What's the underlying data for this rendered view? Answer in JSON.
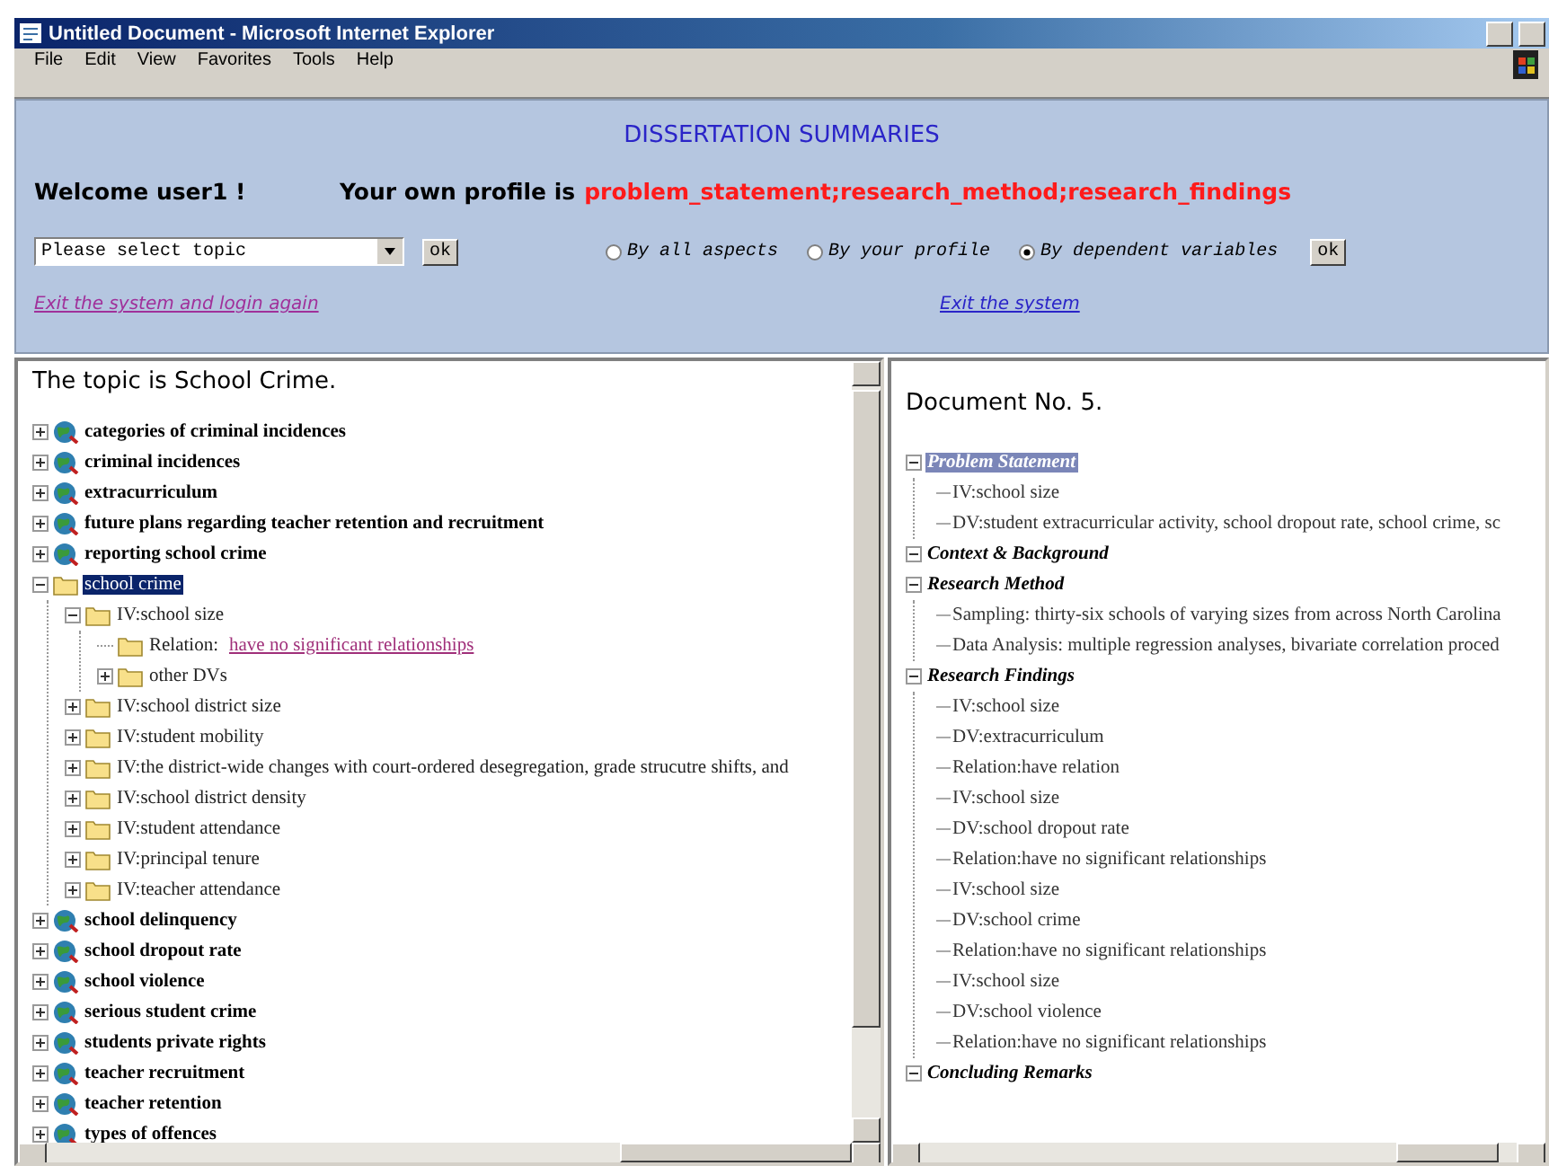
{
  "window": {
    "title": "Untitled Document - Microsoft Internet Explorer"
  },
  "menu": [
    "File",
    "Edit",
    "View",
    "Favorites",
    "Tools",
    "Help"
  ],
  "header": {
    "title": "DISSERTATION SUMMARIES",
    "welcome": "Welcome user1 !",
    "profile_label": "Your own profile is",
    "profile_value": "problem_statement;research_method;research_findings",
    "topic_select": {
      "value": "Please select topic"
    },
    "topic_ok": "ok",
    "view_options": [
      {
        "label": "By all aspects",
        "selected": false
      },
      {
        "label": "By your profile",
        "selected": false
      },
      {
        "label": "By dependent variables",
        "selected": true
      }
    ],
    "view_ok": "ok",
    "links": [
      {
        "label": "Exit the system and login again",
        "visited": true
      },
      {
        "label": "Exit the system",
        "visited": false
      }
    ]
  },
  "topic_tree": {
    "heading": "The topic is School Crime.",
    "items": [
      {
        "kind": "topic",
        "label": "categories of criminal incidences",
        "expanded": false,
        "selected": false
      },
      {
        "kind": "topic",
        "label": "criminal incidences",
        "expanded": false,
        "selected": false
      },
      {
        "kind": "topic",
        "label": "extracurriculum",
        "expanded": false,
        "selected": false
      },
      {
        "kind": "topic",
        "label": "future plans regarding teacher retention and recruitment",
        "expanded": false,
        "selected": false
      },
      {
        "kind": "topic",
        "label": "reporting school crime",
        "expanded": false,
        "selected": false
      },
      {
        "kind": "folder",
        "label": "school crime",
        "expanded": true,
        "selected": true,
        "children": [
          {
            "kind": "folder",
            "label": "IV:school size",
            "expanded": true,
            "selected": false,
            "children": [
              {
                "kind": "folder",
                "label": "Relation:",
                "link": "have no significant relationships",
                "selected": false
              },
              {
                "kind": "folder",
                "label": "other DVs",
                "expanded": false,
                "selected": false
              }
            ]
          },
          {
            "kind": "folder",
            "label": "IV:school district size",
            "expanded": false,
            "selected": false
          },
          {
            "kind": "folder",
            "label": "IV:student mobility",
            "expanded": false,
            "selected": false
          },
          {
            "kind": "folder",
            "label": "IV:the district-wide changes with court-ordered desegregation, grade strucutre shifts, and",
            "expanded": false,
            "selected": false
          },
          {
            "kind": "folder",
            "label": "IV:school district density",
            "expanded": false,
            "selected": false
          },
          {
            "kind": "folder",
            "label": "IV:student attendance",
            "expanded": false,
            "selected": false
          },
          {
            "kind": "folder",
            "label": "IV:principal tenure",
            "expanded": false,
            "selected": false
          },
          {
            "kind": "folder",
            "label": "IV:teacher attendance",
            "expanded": false,
            "selected": false
          }
        ]
      },
      {
        "kind": "topic",
        "label": "school delinquency",
        "expanded": false,
        "selected": false
      },
      {
        "kind": "topic",
        "label": "school dropout rate",
        "expanded": false,
        "selected": false
      },
      {
        "kind": "topic",
        "label": "school violence",
        "expanded": false,
        "selected": false
      },
      {
        "kind": "topic",
        "label": "serious student crime",
        "expanded": false,
        "selected": false
      },
      {
        "kind": "topic",
        "label": "students private rights",
        "expanded": false,
        "selected": false
      },
      {
        "kind": "topic",
        "label": "teacher recruitment",
        "expanded": false,
        "selected": false
      },
      {
        "kind": "topic",
        "label": "teacher retention",
        "expanded": false,
        "selected": false
      },
      {
        "kind": "topic",
        "label": "types of offences",
        "expanded": false,
        "selected": false
      }
    ]
  },
  "document": {
    "heading": "Document No. 5.",
    "sections": [
      {
        "label": "Problem Statement",
        "expanded": true,
        "selected": true,
        "children": [
          "IV:school size",
          "DV:student extracurricular activity, school dropout rate, school crime, sc"
        ]
      },
      {
        "label": "Context & Background",
        "expanded": true,
        "selected": false
      },
      {
        "label": "Research Method",
        "expanded": true,
        "selected": false,
        "children": [
          "Sampling: thirty-six schools of varying sizes from across North Carolina",
          "Data Analysis: multiple regression analyses, bivariate correlation proced"
        ]
      },
      {
        "label": "Research Findings",
        "expanded": true,
        "selected": false,
        "children": [
          "IV:school size",
          "DV:extracurriculum",
          "Relation:have relation",
          "IV:school size",
          "DV:school dropout rate",
          "Relation:have no significant relationships",
          "IV:school size",
          "DV:school crime",
          "Relation:have no significant relationships",
          "IV:school size",
          "DV:school violence",
          "Relation:have no significant relationships"
        ]
      },
      {
        "label": "Concluding Remarks",
        "expanded": true,
        "selected": false
      }
    ]
  }
}
